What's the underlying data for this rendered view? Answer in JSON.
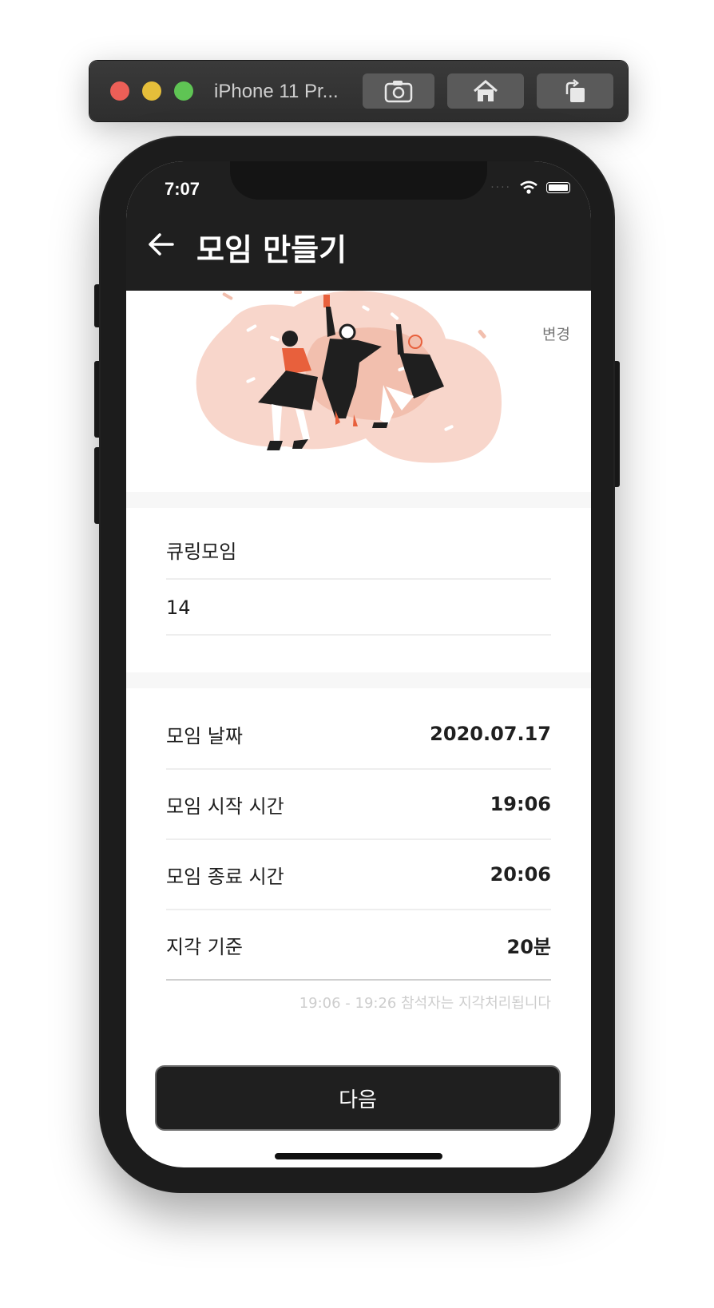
{
  "simulator": {
    "title": "iPhone 11 Pr...",
    "buttons": [
      "screenshot-icon",
      "home-icon",
      "rotate-icon"
    ]
  },
  "status_bar": {
    "time": "7:07"
  },
  "header": {
    "title": "모임 만들기"
  },
  "illustration": {
    "change_label": "변경"
  },
  "form": {
    "name_value": "큐링모임",
    "number_value": "14"
  },
  "details": [
    {
      "label": "모임 날짜",
      "value": "2020.07.17"
    },
    {
      "label": "모임 시작 시간",
      "value": "19:06"
    },
    {
      "label": "모임 종료 시간",
      "value": "20:06"
    },
    {
      "label": "지각 기준",
      "value": "20분"
    }
  ],
  "late_hint": "19:06 - 19:26 참석자는 지각처리됩니다",
  "next_button": "다음",
  "colors": {
    "header_bg": "#1f1f1f",
    "accent": "#e8603c",
    "blob": "#f8d6cb"
  }
}
